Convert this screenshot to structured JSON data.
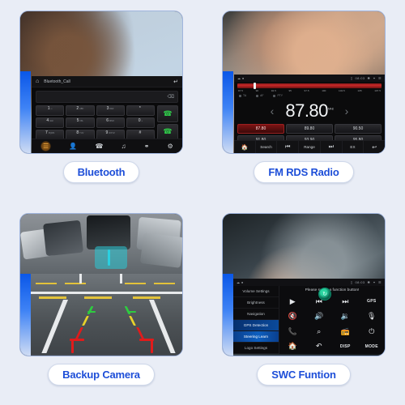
{
  "page": {
    "background_color": "#e9edf6",
    "accent_color": "#1d4ed8",
    "card_border_color": "#9fb4dd"
  },
  "cards": [
    {
      "id": "bluetooth",
      "caption": "Bluetooth",
      "screen": {
        "title": "Bluetooth_Call",
        "home_icon": "home-icon",
        "back_icon": "back-arrow-icon",
        "backspace_icon": "backspace-icon",
        "dial_value": "",
        "keys": [
          {
            "num": "1",
            "sub": "∞"
          },
          {
            "num": "2",
            "sub": "ABC"
          },
          {
            "num": "3",
            "sub": "DEF"
          },
          {
            "num": "*",
            "sub": ""
          },
          {
            "num": "4",
            "sub": "GHI"
          },
          {
            "num": "5",
            "sub": "JKL"
          },
          {
            "num": "6",
            "sub": "MNO"
          },
          {
            "num": "0",
            "sub": "+"
          },
          {
            "num": "7",
            "sub": "PQRS"
          },
          {
            "num": "8",
            "sub": "TUV"
          },
          {
            "num": "9",
            "sub": "WXYZ"
          },
          {
            "num": "#",
            "sub": ""
          }
        ],
        "call_icon": "call-answer-icon",
        "hangup_icon": "call-end-icon",
        "tabs": [
          {
            "name": "dialpad-tab",
            "glyph": "☰",
            "active": true
          },
          {
            "name": "contacts-tab",
            "glyph": "👤",
            "active": false
          },
          {
            "name": "call-history-tab",
            "glyph": "✆",
            "active": false
          },
          {
            "name": "bluetooth-music-tab",
            "glyph": "♫",
            "active": false
          },
          {
            "name": "bluetooth-link-tab",
            "glyph": "⚭",
            "active": false
          },
          {
            "name": "settings-tab",
            "glyph": "⚙",
            "active": false
          }
        ]
      }
    },
    {
      "id": "fm-radio",
      "caption": "FM RDS Radio",
      "screen": {
        "status_time": "08:03",
        "frequency": "87.80",
        "frequency_unit": "MHz",
        "band_ticks": [
          "87.5",
          "90",
          "92.5",
          "95",
          "97.5",
          "100",
          "102.5",
          "105",
          "107.5"
        ],
        "rds_flags": [
          "TA",
          "AF",
          "PTY"
        ],
        "prev_icon": "chevron-left-icon",
        "next_icon": "chevron-right-icon",
        "presets": [
          {
            "value": "87.80",
            "active": true
          },
          {
            "value": "89.80",
            "active": false
          },
          {
            "value": "90.50",
            "active": false
          },
          {
            "value": "91.80",
            "active": false
          },
          {
            "value": "93.90",
            "active": false
          },
          {
            "value": "95.80",
            "active": false
          }
        ],
        "bottom_bar": [
          {
            "name": "home-button",
            "label": "🏠",
            "icon": true
          },
          {
            "name": "search-button",
            "label": "Search",
            "icon": false
          },
          {
            "name": "prev-station-button",
            "label": "⏮",
            "icon": true
          },
          {
            "name": "range-button",
            "label": "Range",
            "icon": false
          },
          {
            "name": "next-station-button",
            "label": "⏭",
            "icon": true
          },
          {
            "name": "ex-button",
            "label": "EX",
            "icon": false
          },
          {
            "name": "back-button",
            "label": "↩",
            "icon": true
          }
        ]
      }
    },
    {
      "id": "backup-camera",
      "caption": "Backup Camera"
    },
    {
      "id": "swc",
      "caption": "SWC Funtion",
      "screen": {
        "status_time": "08:03",
        "prompt": "Please select a function button!",
        "menu": [
          {
            "label": "Volume Settings",
            "state": "normal"
          },
          {
            "label": "Brightness",
            "state": "normal"
          },
          {
            "label": "Navigation",
            "state": "normal"
          },
          {
            "label": "GPS Detection",
            "state": "highlight"
          },
          {
            "label": "Steering Learn",
            "state": "selected"
          },
          {
            "label": "Logo Settings",
            "state": "normal"
          }
        ],
        "knob_icon": "rotary-knob-icon",
        "buttons": [
          {
            "name": "play-button",
            "glyph": "▶",
            "text": false
          },
          {
            "name": "previous-track-button",
            "glyph": "⏮",
            "text": false
          },
          {
            "name": "next-track-button",
            "glyph": "⏭",
            "text": false
          },
          {
            "name": "gps-button",
            "glyph": "GPS",
            "text": true
          },
          {
            "name": "mute-button",
            "glyph": "🔇",
            "text": false
          },
          {
            "name": "volume-up-button",
            "glyph": "🔊",
            "text": false
          },
          {
            "name": "volume-down-button",
            "glyph": "🔉",
            "text": false
          },
          {
            "name": "microphone-button",
            "glyph": "🎙",
            "text": false
          },
          {
            "name": "call-answer-button",
            "glyph": "📞",
            "text": false
          },
          {
            "name": "call-end-button",
            "glyph": "⌕",
            "text": false
          },
          {
            "name": "radio-button",
            "glyph": "📻",
            "text": false
          },
          {
            "name": "power-button",
            "glyph": "⏻",
            "text": false
          },
          {
            "name": "home-button",
            "glyph": "🏠",
            "text": false
          },
          {
            "name": "back-button",
            "glyph": "↶",
            "text": false
          },
          {
            "name": "disp-button",
            "glyph": "DISP",
            "text": true
          },
          {
            "name": "mode-button",
            "glyph": "MODE",
            "text": true
          }
        ]
      }
    }
  ]
}
